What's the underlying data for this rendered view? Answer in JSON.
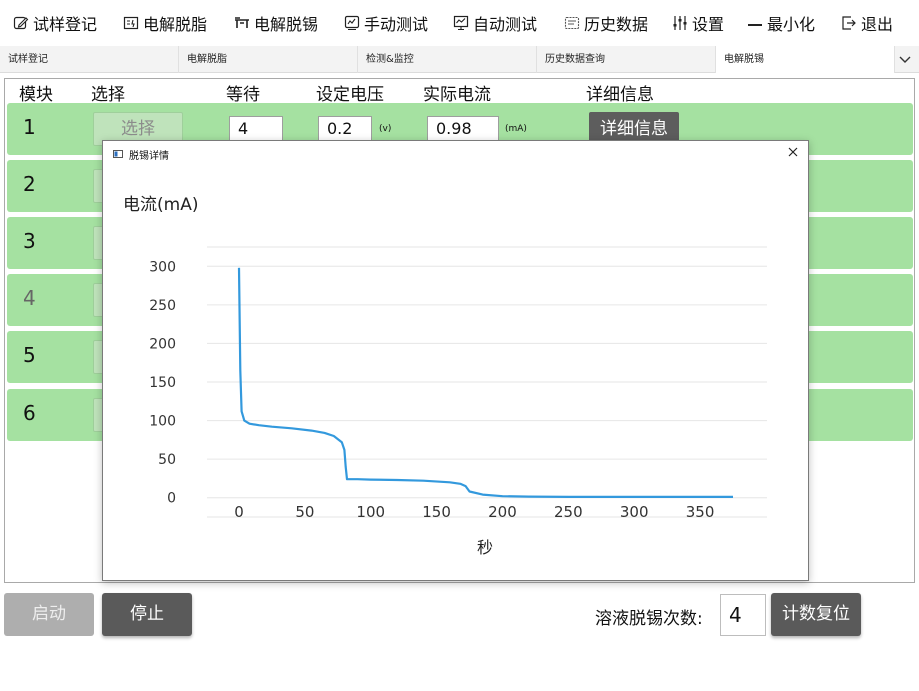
{
  "toolbar": {
    "items": [
      {
        "label": "试样登记",
        "icon": "edit-icon"
      },
      {
        "label": "电解脱脂",
        "icon": "electrolysis-icon"
      },
      {
        "label": "电解脱锡",
        "icon": "tin-icon"
      },
      {
        "label": "手动测试",
        "icon": "manual-test-icon"
      },
      {
        "label": "自动测试",
        "icon": "auto-test-icon"
      },
      {
        "label": "历史数据",
        "icon": "history-icon"
      },
      {
        "label": "设置",
        "icon": "settings-sliders-icon"
      },
      {
        "label": "最小化",
        "icon": "minimize-icon"
      },
      {
        "label": "退出",
        "icon": "exit-icon"
      }
    ]
  },
  "tabs": [
    {
      "label": "试样登记",
      "active": false
    },
    {
      "label": "电解脱脂",
      "active": false
    },
    {
      "label": "检测&监控",
      "active": false
    },
    {
      "label": "历史数据查询",
      "active": false
    },
    {
      "label": "电解脱锡",
      "active": true
    }
  ],
  "table": {
    "headers": {
      "module": "模块",
      "select": "选择",
      "wait": "等待",
      "set_voltage": "设定电压",
      "actual_current": "实际电流",
      "details": "详细信息"
    },
    "rows": [
      {
        "num": "1",
        "select_label": "选择",
        "wait": "4",
        "voltage": "0.2",
        "voltage_unit": "(v)",
        "current": "0.98",
        "current_unit": "(mA)",
        "detail_label": "详细信息"
      },
      {
        "num": "2"
      },
      {
        "num": "3"
      },
      {
        "num": "4"
      },
      {
        "num": "5"
      },
      {
        "num": "6"
      }
    ]
  },
  "dialog": {
    "title": "脱锡详情",
    "close_icon": "close-icon"
  },
  "chart_data": {
    "type": "line",
    "title": "",
    "ylabel": "电流(mA)",
    "xlabel": "秒",
    "xlim": [
      0,
      375
    ],
    "ylim": [
      -25,
      325
    ],
    "xticks": [
      "0",
      "50",
      "100",
      "150",
      "200",
      "250",
      "300",
      "350"
    ],
    "yticks": [
      "0",
      "50",
      "100",
      "150",
      "200",
      "250",
      "300"
    ],
    "grid": true,
    "color": "#3399dd",
    "series": [
      {
        "name": "",
        "x": [
          0,
          1,
          2,
          4,
          8,
          15,
          25,
          40,
          55,
          65,
          72,
          78,
          80,
          81,
          82,
          90,
          100,
          120,
          140,
          160,
          168,
          172,
          175,
          185,
          200,
          220,
          250,
          300,
          350,
          375
        ],
        "y": [
          298,
          165,
          112,
          100,
          96,
          94,
          92,
          90,
          87,
          84,
          80,
          72,
          62,
          40,
          24,
          24,
          23.5,
          23,
          22,
          20,
          18,
          15,
          8,
          4,
          2,
          1.5,
          1,
          1,
          1,
          1
        ]
      }
    ]
  },
  "controls": {
    "start_label": "启动",
    "stop_label": "停止",
    "count_label": "溶液脱锡次数:",
    "count_value": "4",
    "reset_label": "计数复位"
  }
}
